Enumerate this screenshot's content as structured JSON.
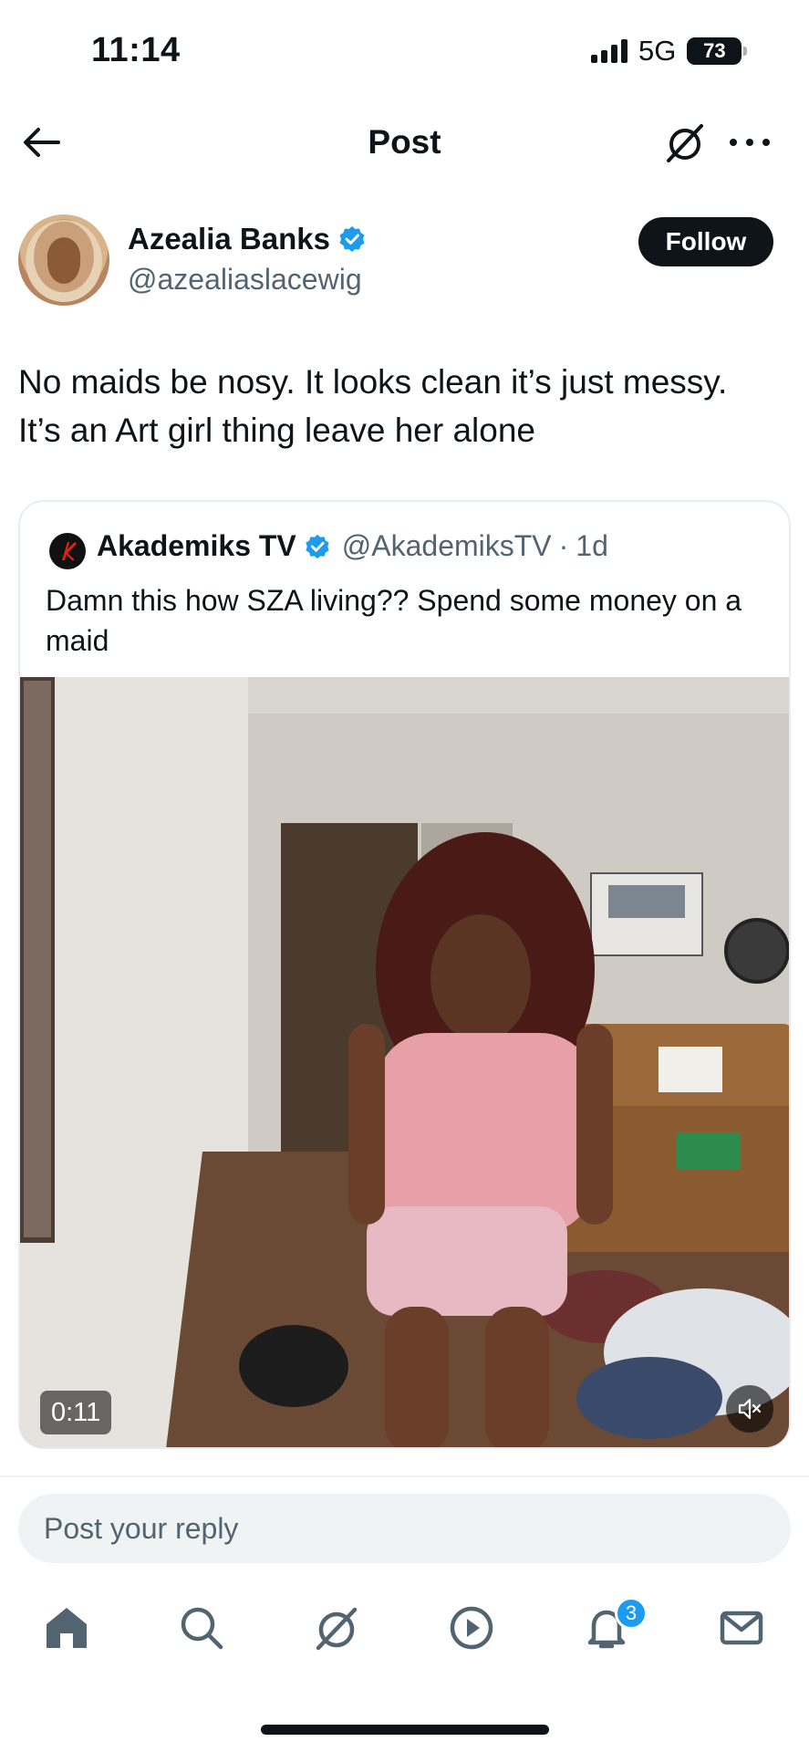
{
  "status_bar": {
    "time": "11:14",
    "network": "5G",
    "battery": "73"
  },
  "header": {
    "title": "Post",
    "icons": [
      "arrow-left-icon",
      "grok-icon",
      "more-icon"
    ]
  },
  "post": {
    "author_name": "Azealia Banks",
    "author_handle": "@azealiaslacewig",
    "verified": true,
    "follow_label": "Follow",
    "text_line1": "No maids be nosy. It looks clean it’s just messy.",
    "text_line2": "It’s an Art girl thing leave her alone"
  },
  "quote": {
    "author_name": "Akademiks TV",
    "author_handle": "@AkademiksTV",
    "separator": "·",
    "time_ago": "1d",
    "text": "Damn this how SZA living?? Spend some money on a maid",
    "video_duration": "0:11"
  },
  "reply": {
    "placeholder": "Post your reply"
  },
  "bottom_nav": {
    "items": [
      "home-icon",
      "search-icon",
      "grok-icon",
      "video-icon",
      "notifications-icon",
      "messages-icon"
    ],
    "notification_count": "3"
  },
  "colors": {
    "text": "#0f1419",
    "secondary": "#536471",
    "accent": "#1d9bf0",
    "reply_bg": "#eff3f4"
  }
}
